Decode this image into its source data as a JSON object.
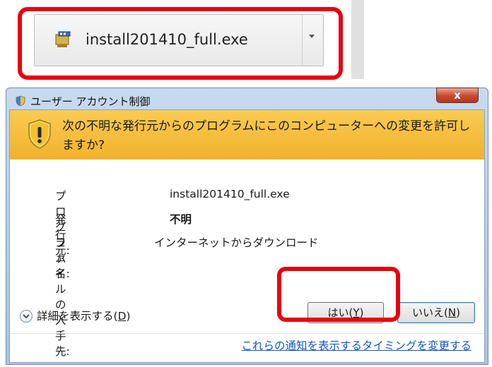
{
  "download_bar": {
    "file_name": "install201410_full.exe",
    "icon": "installer-icon",
    "dropdown_icon": "chevron-down-icon"
  },
  "uac": {
    "title": "ユーザー アカウント制御",
    "title_icon": "shield-icon",
    "close_label": "x",
    "banner_icon": "warning-shield-icon",
    "message": "次の不明な発行元からのプログラムにこのコンピューターへの変更を許可しますか?",
    "info": {
      "program_label": "プログラム名:",
      "program_value": "install201410_full.exe",
      "publisher_label": "発行元:",
      "publisher_value": "不明",
      "source_label": "ファイルの入手先:",
      "source_value": "インターネットからダウンロード"
    },
    "details": {
      "label": "詳細を表示する(",
      "key": "D",
      "close": ")"
    },
    "buttons": {
      "yes": {
        "label": "はい(",
        "key": "Y",
        "close": ")"
      },
      "no": {
        "label": "いいえ(",
        "key": "N",
        "close": ")"
      }
    },
    "link": "これらの通知を表示するタイミングを変更する"
  },
  "colors": {
    "highlight": "#e8000f",
    "banner": "#f2b12b",
    "link": "#1155cc"
  }
}
